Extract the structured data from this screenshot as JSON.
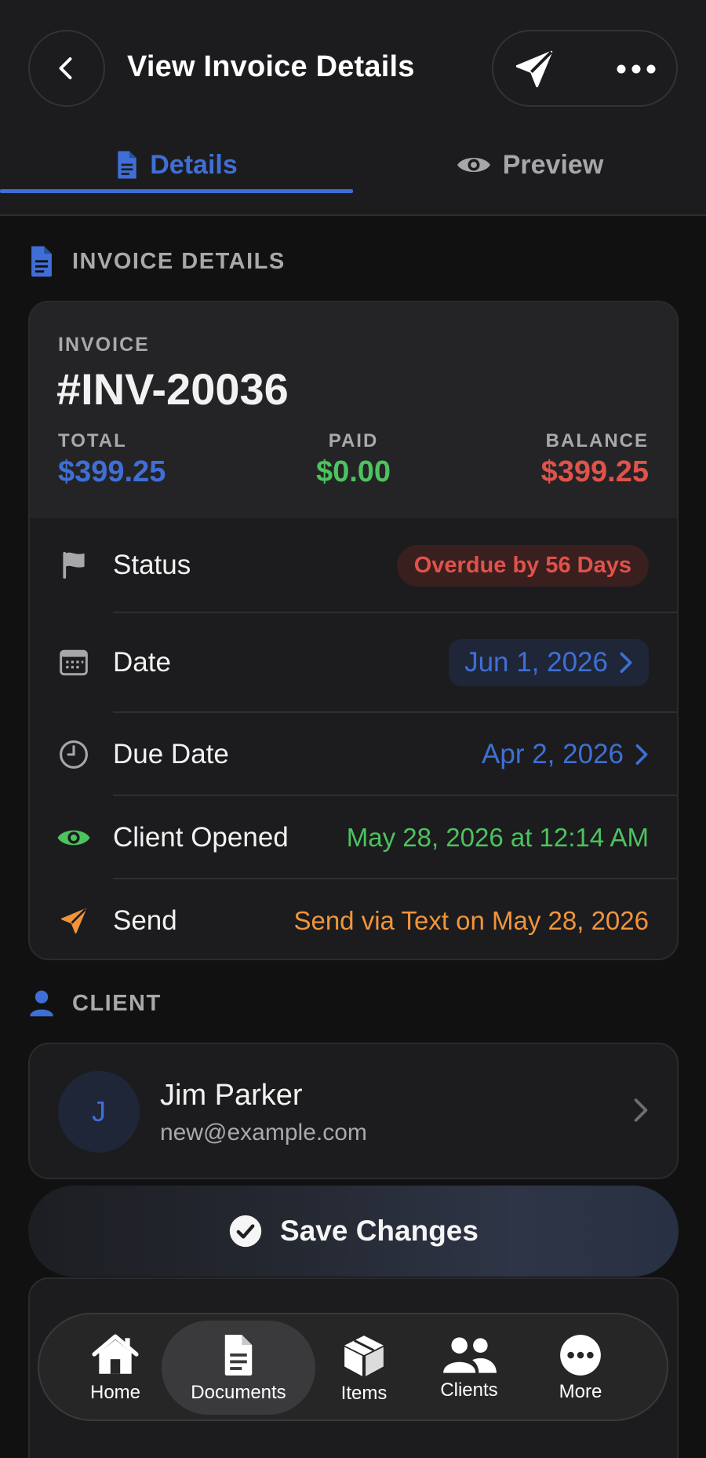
{
  "header": {
    "title": "View Invoice Details",
    "back_icon": "chevron-left-icon",
    "send_icon": "paper-plane-icon",
    "more_icon": "ellipsis-icon"
  },
  "tabs": [
    {
      "label": "Details",
      "icon": "document-icon",
      "active": true
    },
    {
      "label": "Preview",
      "icon": "eye-icon",
      "active": false
    }
  ],
  "invoice_section": {
    "heading": "INVOICE DETAILS",
    "invoice_label": "INVOICE",
    "invoice_number": "#INV-20036",
    "total_label": "TOTAL",
    "total_value": "$399.25",
    "paid_label": "PAID",
    "paid_value": "$0.00",
    "balance_label": "BALANCE",
    "balance_value": "$399.25",
    "rows": {
      "status": {
        "label": "Status",
        "value": "Overdue by 56 Days"
      },
      "date": {
        "label": "Date",
        "value": "Jun 1, 2026"
      },
      "due_date": {
        "label": "Due Date",
        "value": "Apr 2, 2026"
      },
      "client_opened": {
        "label": "Client Opened",
        "value": "May 28, 2026 at 12:14 AM"
      },
      "send": {
        "label": "Send",
        "value": "Send via Text on May 28, 2026"
      }
    }
  },
  "client_section": {
    "heading": "CLIENT",
    "avatar_initial": "J",
    "name": "Jim Parker",
    "email": "new@example.com"
  },
  "save_button": {
    "label": "Save Changes"
  },
  "tab_bar": {
    "items": [
      {
        "label": "Home",
        "icon": "house-icon"
      },
      {
        "label": "Documents",
        "icon": "document-icon",
        "active": true
      },
      {
        "label": "Items",
        "icon": "box-icon"
      },
      {
        "label": "Clients",
        "icon": "people-icon"
      },
      {
        "label": "More",
        "icon": "ellipsis-circle-icon"
      }
    ]
  },
  "colors": {
    "accent_blue": "#3f6fd6",
    "paid_green": "#4cc35f",
    "balance_red": "#e0524a",
    "send_orange": "#f0953c",
    "background": "#111111",
    "card": "#1c1c1e"
  }
}
